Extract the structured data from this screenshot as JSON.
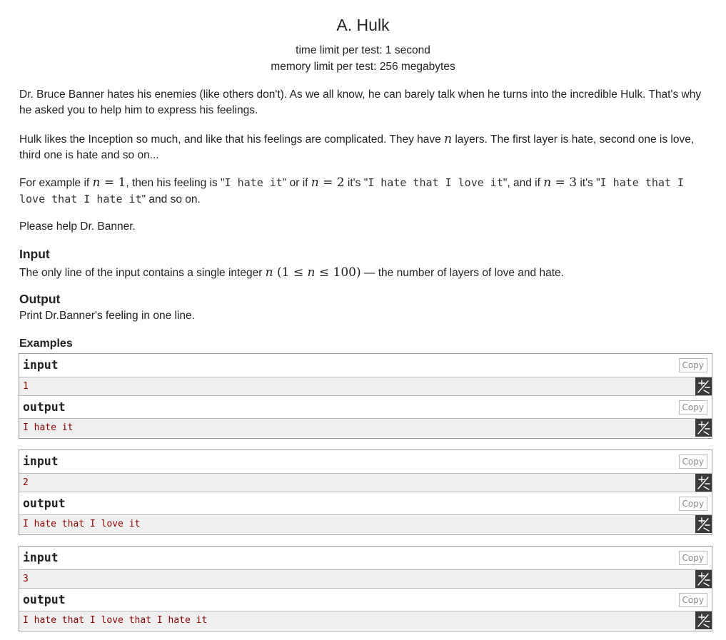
{
  "problem": {
    "title": "A. Hulk",
    "time_limit": "time limit per test: 1 second",
    "memory_limit": "memory limit per test: 256 megabytes"
  },
  "statement": {
    "p1": "Dr. Bruce Banner hates his enemies (like others don't). As we all know, he can barely talk when he turns into the incredible Hulk. That's why he asked you to help him to express his feelings.",
    "p2_a": "Hulk likes the Inception so much, and like that his feelings are complicated. They have ",
    "p2_n": "n",
    "p2_b": " layers. The first layer is hate, second one is love, third one is hate and so on...",
    "p3_a": "For example if ",
    "p3_n1": "n",
    "p3_eq1": " = 1",
    "p3_b": ", then his feeling is \"",
    "p3_c1": "I hate it",
    "p3_d": "\" or if ",
    "p3_n2": "n",
    "p3_eq2": " = 2",
    "p3_e": " it's \"",
    "p3_c2": "I hate that I love it",
    "p3_f": "\", and if ",
    "p3_n3": "n",
    "p3_eq3": " = 3",
    "p3_g": " it's \"",
    "p3_c3": "I hate that I love that I hate it",
    "p3_h": "\" and so on.",
    "p4": "Please help Dr. Banner."
  },
  "input_section": {
    "title": "Input",
    "text_a": "The only line of the input contains a single integer ",
    "n": "n",
    "range_open": " (1 ≤ ",
    "range_n": "n",
    "range_close": " ≤ 100)",
    "text_b": " — the number of layers of love and hate."
  },
  "output_section": {
    "title": "Output",
    "text": "Print Dr.Banner's feeling in one line."
  },
  "examples": {
    "title": "Examples",
    "copy_label": "Copy",
    "input_label": "input",
    "output_label": "output",
    "items": [
      {
        "input": "1",
        "output": "I hate it"
      },
      {
        "input": "2",
        "output": "I hate that I love it"
      },
      {
        "input": "3",
        "output": "I hate that I love that I hate it"
      }
    ]
  },
  "icons": {
    "copy": "copy-icon",
    "tool": "sparkle-tool-icon"
  }
}
